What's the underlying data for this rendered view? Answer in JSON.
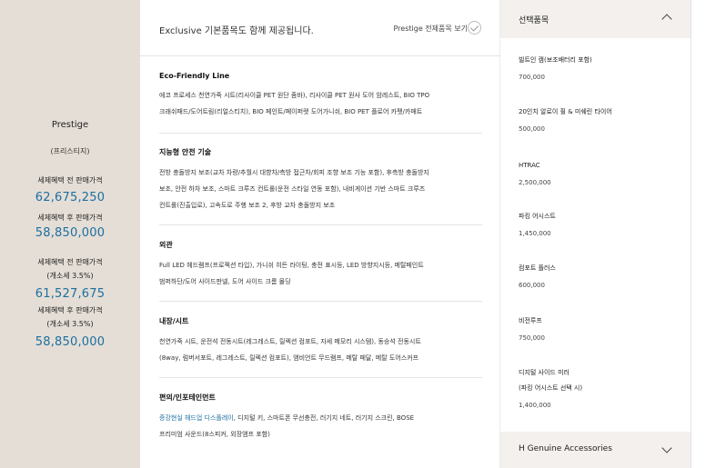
{
  "trim": {
    "name": "Prestige",
    "sub": "(프리스티지)",
    "label_before": "세제혜택 전 판매가격",
    "price_before": "62,675,250",
    "label_after": "세제혜택 후 판매가격",
    "price_after": "58,850,000",
    "label_before2": "세제혜택 전 판매가격",
    "tax_note1": "(개소세 3.5%)",
    "price_before2": "61,527,675",
    "label_after2": "세제혜택 후 판매가격",
    "tax_note2": "(개소세 3.5%)",
    "price_after2": "58,850,000"
  },
  "basic": {
    "title": "Exclusive 기본품목도 함께 제공됩니다.",
    "link": "Prestige 전체품목 보기",
    "sections": [
      {
        "title": "Eco-Friendly Line",
        "lines": [
          "에코 프로세스 천연가죽 시트(리사이클 PET 원단 좀바), 리사이클 PET 원사 도어 암레스트, BIO TPO",
          "크래쉬패드/도어트림(리얼스티치), BIO 페인트/페이퍼렛 도어가니쉬, BIO PET 플로어 카펫/카매트"
        ]
      },
      {
        "title": "지능형 안전 기술",
        "lines": [
          "전방 충돌방지 보조(교차 차량/추월시 대향차/측방 접근차/회피 조향 보조 기능 포함), 후측방 충돌방지",
          "보조, 안전 하차 보조, 스마트 크루즈 컨트롤(운전 스타일 연동 포함), 내비게이션 기반 스마트 크루즈",
          "컨트롤(진출입로), 고속도로 주행 보조 2, 후방 교차 충돌방지 보조"
        ]
      },
      {
        "title": "외관",
        "lines": [
          "Full LED 헤드램프(프로젝션 타입), 가니쉬 히든 라이팅, 충전 표시등, LED 방향지시등, 메탈페인트",
          "범퍼하단/도어 사이드판넬, 도어 사이드 크롬 몰딩"
        ]
      },
      {
        "title": "내장/시트",
        "lines": [
          "천연가죽 시트, 운전석 전동시트(레그레스트, 릴렉션 컴포트, 자세 메모리 시스템), 동승석 전동시트",
          "(8way, 럼버서포트, 레그레스트, 릴렉션 컴포트), 앰비언트 무드램프, 메탈 페달, 메탈 도어스커프"
        ]
      },
      {
        "title": "편의/인포테인먼트",
        "highlight": "증강현실 헤드업 디스플레이",
        "lines": [
          ", 디지털 키, 스마트폰 무선충전, 러기지 네트, 러기지 스크린, BOSE",
          "프리미엄 사운드(8스피커, 외장앰프 포함)"
        ]
      }
    ]
  },
  "options": {
    "title": "선택품목",
    "items": [
      {
        "name": "빌트인 캠(보조배터리 포함)",
        "price": "700,000"
      },
      {
        "name": "20인치 알로이 휠 & 미쉐린 타이어",
        "price": "500,000"
      },
      {
        "name": "HTRAC",
        "price": "2,500,000"
      },
      {
        "name": "파킹 어시스트",
        "price": "1,450,000"
      },
      {
        "name": "컴포트 플러스",
        "price": "600,000"
      },
      {
        "name": "비전루프",
        "price": "750,000"
      },
      {
        "name": "디지털 사이드 미러",
        "sub": "(파킹 어시스트 선택 시)",
        "price": "1,400,000"
      }
    ],
    "footer": "H Genuine Accessories"
  },
  "colors": {
    "accent": "#1b6fa0",
    "trim_bg": "#e5ded6",
    "header_bg": "#f3f0ed"
  }
}
